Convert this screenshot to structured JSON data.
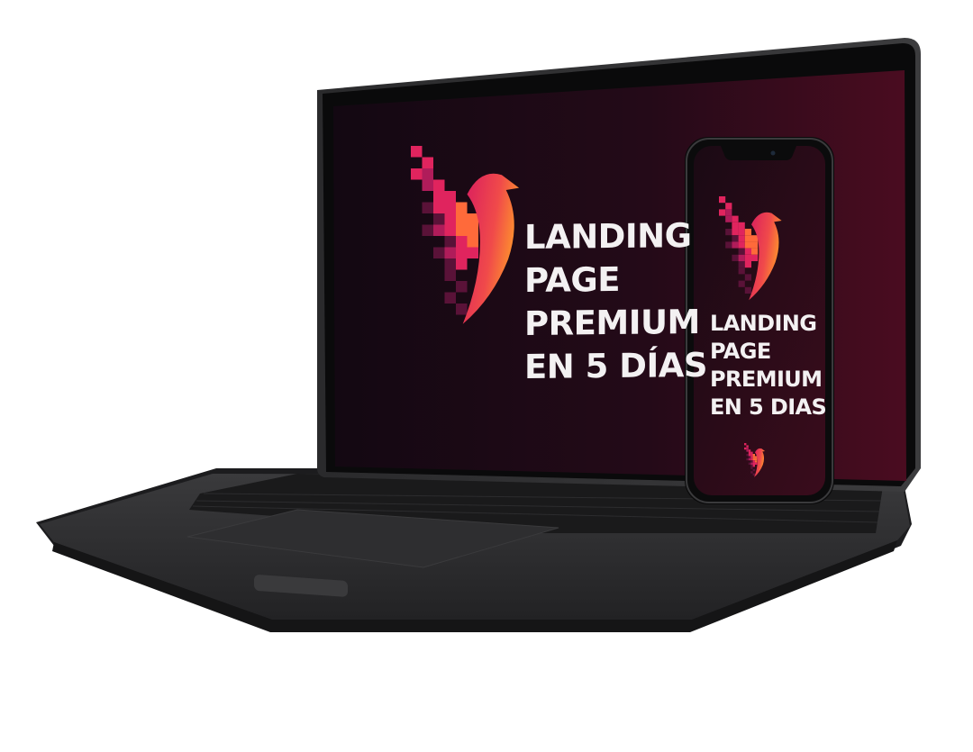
{
  "screen": {
    "headline_lines": [
      "LANDING",
      "PAGE",
      "PREMIUM",
      "EN 5 DÍAS"
    ]
  },
  "phone": {
    "headline_lines": [
      "LANDING",
      "PAGE",
      "PREMIUM",
      "EN 5 DIAS"
    ]
  },
  "colors": {
    "screen_bg_dark": "#120710",
    "screen_bg_mid": "#2a0b1c",
    "screen_bg_right": "#4a0c20",
    "brand_magenta": "#e0245e",
    "brand_pink": "#c01e66",
    "brand_orange": "#ff7a2a",
    "brand_yellow": "#ffb12e",
    "text": "#f3f1f2",
    "laptop_body": "#2b2b2d"
  },
  "icons": [
    "phoenix-logo-icon",
    "phoenix-mini-logo-icon"
  ]
}
